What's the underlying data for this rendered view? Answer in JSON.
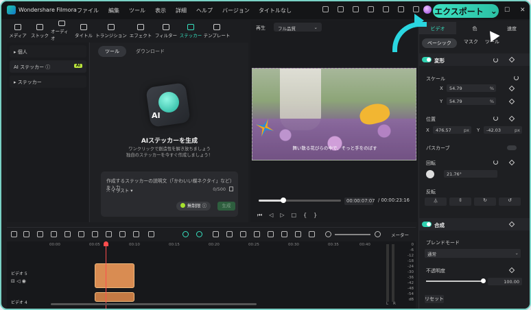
{
  "app": {
    "name": "Wondershare Filmora",
    "doc_title": "タイトルなし",
    "export_label": "エクスポート"
  },
  "menu": [
    "ファイル",
    "編集",
    "ツール",
    "表示",
    "詳細",
    "ヘルプ",
    "バージョン"
  ],
  "toolbar": [
    "メディア",
    "ストック",
    "オーディオ",
    "タイトル",
    "トランジション",
    "エフェクト",
    "フィルター",
    "ステッカー",
    "テンプレート"
  ],
  "left_panel": {
    "items": [
      "個人",
      "AI ステッカー",
      "ステッカー"
    ],
    "badge": "AI"
  },
  "content": {
    "tab_active": "ツール",
    "tab_other": "ダウンロード",
    "sticker_text": "AI",
    "title": "AIステッカーを生成",
    "subtitle_1": "ワンクリックで創造性を解き放ちましょう",
    "subtitle_2": "独自のステッカーを今すぐ作成しましょう！",
    "prompt_placeholder": "作成するステッカーの説明文（「かわいい蝶ネクタイ」など）を入力",
    "style": "イラスト",
    "count": "0/500",
    "credits": "無制限",
    "generate": "生成"
  },
  "preview": {
    "label": "再生",
    "quality": "フル品質",
    "caption": "舞い散る花びらの中で、そっと手をのばす",
    "time_current": "00:00:07:07",
    "time_total": "/ 00:00:23:16",
    "progress": 0.3
  },
  "right_panel": {
    "tabs": [
      "ビデオ",
      "色",
      "速度"
    ],
    "subtabs": [
      "ベーシック",
      "マスク",
      "ツール"
    ],
    "transform_title": "変形",
    "scale_label": "スケール",
    "scale_x": "54.79",
    "scale_y": "54.79",
    "unit_pct": "%",
    "position_label": "位置",
    "pos_x": "476.57",
    "pos_y": "-42.03",
    "unit_px": "px",
    "path_curve_label": "パスカーブ",
    "rotate_label": "回転",
    "rotate_value": "21.76°",
    "flip_label": "反転",
    "composite_title": "合成",
    "blend_label": "ブレンドモード",
    "blend_value": "通常",
    "opacity_label": "不透明度",
    "opacity_value": "100.00",
    "opacity": 1.0,
    "reset": "リセット"
  },
  "timeline": {
    "meter_label": "メーター",
    "ticks": [
      "00:00",
      "00:05",
      "00:10",
      "00:15",
      "00:20",
      "00:25",
      "00:30",
      "00:35",
      "00:40"
    ],
    "tracks": [
      "ビデオ 5",
      "ビデオ 4"
    ],
    "vu_scale": [
      "0",
      "-6",
      "-12",
      "-18",
      "-24",
      "-30",
      "-36",
      "-42",
      "-48",
      "-54",
      "dB"
    ],
    "vu_lr": [
      "L",
      "R"
    ]
  }
}
